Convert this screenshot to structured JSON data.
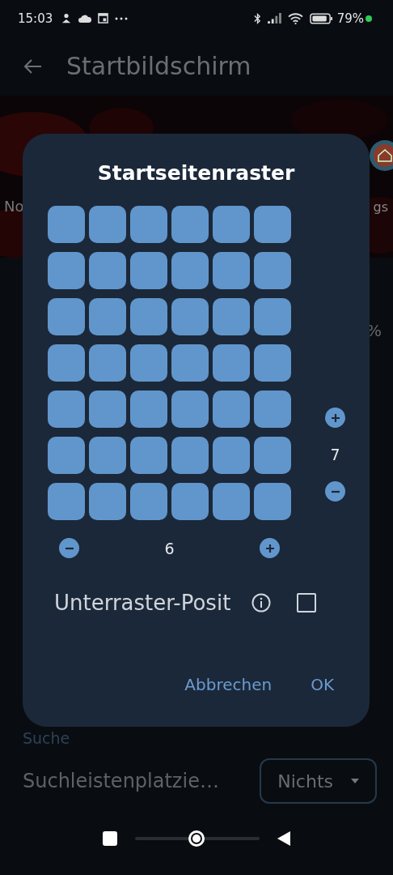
{
  "status_bar": {
    "time": "15:03",
    "battery": "79%"
  },
  "header": {
    "title": "Startbildschirm"
  },
  "background": {
    "left_label": "No",
    "right_label": "gs",
    "fragment": "%"
  },
  "dialog": {
    "title": "Startseitenraster",
    "grid": {
      "rows": "7",
      "columns": "6"
    },
    "option": {
      "label": "Unterraster-Posit",
      "checked": false
    },
    "buttons": [
      "Abbrechen",
      "OK"
    ]
  },
  "search_section": {
    "heading": "Suche",
    "setting": {
      "label": "Suchleistenplatzie…",
      "value": "Nichts"
    }
  }
}
